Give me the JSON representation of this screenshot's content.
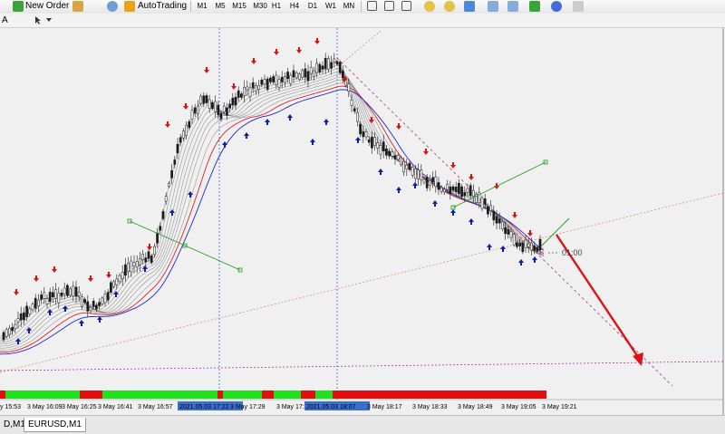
{
  "toolbar": {
    "new_order_label": "New Order",
    "autotrading_label": "AutoTrading",
    "timeframes": [
      "M1",
      "M5",
      "M15",
      "M30",
      "H1",
      "H4",
      "D1",
      "W1",
      "MN"
    ],
    "colors": {
      "new_order_icon": "#3aa43a",
      "autotrading_icon": "#e8a317"
    }
  },
  "toolbar2": {
    "left_label": "A",
    "tool_icons": [
      "arrow-cursor-icon",
      "dropdown-icon"
    ]
  },
  "chart": {
    "symbol": "EURUSD,M1",
    "time_axis_labels": [
      "y 15:53",
      "3 May 16:09",
      "3 May 16:25",
      "3 May 16:41",
      "3 May 16:57",
      "2021.05.03 17:22",
      "3 May 17:29",
      "3 May 17:4",
      "2021.05.03 18:07",
      "3 May 18:17",
      "3 May 18:33",
      "3 May 18:49",
      "3 May 19:05",
      "3 May 19:21"
    ],
    "label_time": "01:00",
    "colors": {
      "background": "#f0f0f0",
      "candle": "#1a1a1a",
      "buy_arrow": "#0b1fa0",
      "sell_arrow": "#e01010",
      "ma_fast": "#e02020",
      "ma_slow": "#1a2bd0",
      "trend_line": "#1a9a1a",
      "signal_up": "#20e020",
      "signal_down": "#e01010",
      "arrow_red": "#e01010"
    }
  },
  "tabs": {
    "left_tab": "D,M1",
    "active_tab": "EURUSD,M1"
  }
}
